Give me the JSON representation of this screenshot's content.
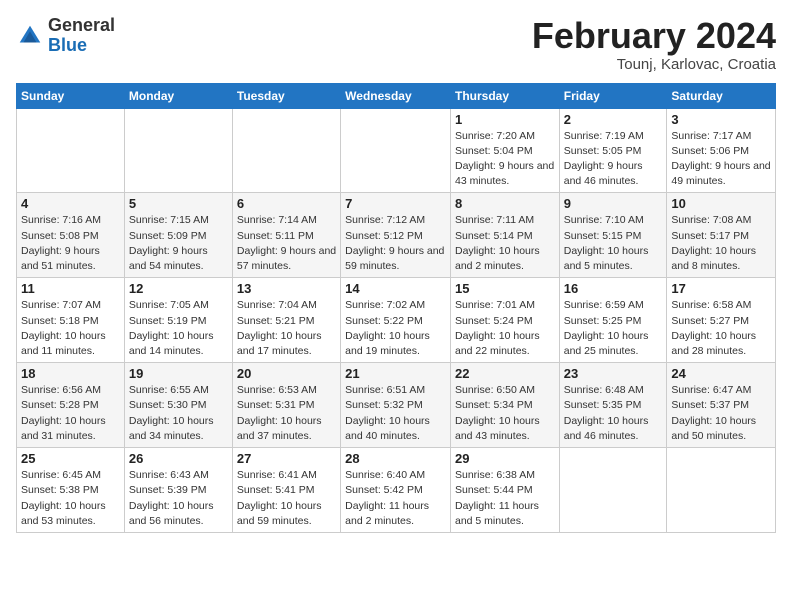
{
  "header": {
    "logo": {
      "general": "General",
      "blue": "Blue"
    },
    "title": "February 2024",
    "location": "Tounj, Karlovac, Croatia"
  },
  "calendar": {
    "weekdays": [
      "Sunday",
      "Monday",
      "Tuesday",
      "Wednesday",
      "Thursday",
      "Friday",
      "Saturday"
    ],
    "weeks": [
      [
        {
          "day": "",
          "sunrise": "",
          "sunset": "",
          "daylight": ""
        },
        {
          "day": "",
          "sunrise": "",
          "sunset": "",
          "daylight": ""
        },
        {
          "day": "",
          "sunrise": "",
          "sunset": "",
          "daylight": ""
        },
        {
          "day": "",
          "sunrise": "",
          "sunset": "",
          "daylight": ""
        },
        {
          "day": "1",
          "sunrise": "Sunrise: 7:20 AM",
          "sunset": "Sunset: 5:04 PM",
          "daylight": "Daylight: 9 hours and 43 minutes."
        },
        {
          "day": "2",
          "sunrise": "Sunrise: 7:19 AM",
          "sunset": "Sunset: 5:05 PM",
          "daylight": "Daylight: 9 hours and 46 minutes."
        },
        {
          "day": "3",
          "sunrise": "Sunrise: 7:17 AM",
          "sunset": "Sunset: 5:06 PM",
          "daylight": "Daylight: 9 hours and 49 minutes."
        }
      ],
      [
        {
          "day": "4",
          "sunrise": "Sunrise: 7:16 AM",
          "sunset": "Sunset: 5:08 PM",
          "daylight": "Daylight: 9 hours and 51 minutes."
        },
        {
          "day": "5",
          "sunrise": "Sunrise: 7:15 AM",
          "sunset": "Sunset: 5:09 PM",
          "daylight": "Daylight: 9 hours and 54 minutes."
        },
        {
          "day": "6",
          "sunrise": "Sunrise: 7:14 AM",
          "sunset": "Sunset: 5:11 PM",
          "daylight": "Daylight: 9 hours and 57 minutes."
        },
        {
          "day": "7",
          "sunrise": "Sunrise: 7:12 AM",
          "sunset": "Sunset: 5:12 PM",
          "daylight": "Daylight: 9 hours and 59 minutes."
        },
        {
          "day": "8",
          "sunrise": "Sunrise: 7:11 AM",
          "sunset": "Sunset: 5:14 PM",
          "daylight": "Daylight: 10 hours and 2 minutes."
        },
        {
          "day": "9",
          "sunrise": "Sunrise: 7:10 AM",
          "sunset": "Sunset: 5:15 PM",
          "daylight": "Daylight: 10 hours and 5 minutes."
        },
        {
          "day": "10",
          "sunrise": "Sunrise: 7:08 AM",
          "sunset": "Sunset: 5:17 PM",
          "daylight": "Daylight: 10 hours and 8 minutes."
        }
      ],
      [
        {
          "day": "11",
          "sunrise": "Sunrise: 7:07 AM",
          "sunset": "Sunset: 5:18 PM",
          "daylight": "Daylight: 10 hours and 11 minutes."
        },
        {
          "day": "12",
          "sunrise": "Sunrise: 7:05 AM",
          "sunset": "Sunset: 5:19 PM",
          "daylight": "Daylight: 10 hours and 14 minutes."
        },
        {
          "day": "13",
          "sunrise": "Sunrise: 7:04 AM",
          "sunset": "Sunset: 5:21 PM",
          "daylight": "Daylight: 10 hours and 17 minutes."
        },
        {
          "day": "14",
          "sunrise": "Sunrise: 7:02 AM",
          "sunset": "Sunset: 5:22 PM",
          "daylight": "Daylight: 10 hours and 19 minutes."
        },
        {
          "day": "15",
          "sunrise": "Sunrise: 7:01 AM",
          "sunset": "Sunset: 5:24 PM",
          "daylight": "Daylight: 10 hours and 22 minutes."
        },
        {
          "day": "16",
          "sunrise": "Sunrise: 6:59 AM",
          "sunset": "Sunset: 5:25 PM",
          "daylight": "Daylight: 10 hours and 25 minutes."
        },
        {
          "day": "17",
          "sunrise": "Sunrise: 6:58 AM",
          "sunset": "Sunset: 5:27 PM",
          "daylight": "Daylight: 10 hours and 28 minutes."
        }
      ],
      [
        {
          "day": "18",
          "sunrise": "Sunrise: 6:56 AM",
          "sunset": "Sunset: 5:28 PM",
          "daylight": "Daylight: 10 hours and 31 minutes."
        },
        {
          "day": "19",
          "sunrise": "Sunrise: 6:55 AM",
          "sunset": "Sunset: 5:30 PM",
          "daylight": "Daylight: 10 hours and 34 minutes."
        },
        {
          "day": "20",
          "sunrise": "Sunrise: 6:53 AM",
          "sunset": "Sunset: 5:31 PM",
          "daylight": "Daylight: 10 hours and 37 minutes."
        },
        {
          "day": "21",
          "sunrise": "Sunrise: 6:51 AM",
          "sunset": "Sunset: 5:32 PM",
          "daylight": "Daylight: 10 hours and 40 minutes."
        },
        {
          "day": "22",
          "sunrise": "Sunrise: 6:50 AM",
          "sunset": "Sunset: 5:34 PM",
          "daylight": "Daylight: 10 hours and 43 minutes."
        },
        {
          "day": "23",
          "sunrise": "Sunrise: 6:48 AM",
          "sunset": "Sunset: 5:35 PM",
          "daylight": "Daylight: 10 hours and 46 minutes."
        },
        {
          "day": "24",
          "sunrise": "Sunrise: 6:47 AM",
          "sunset": "Sunset: 5:37 PM",
          "daylight": "Daylight: 10 hours and 50 minutes."
        }
      ],
      [
        {
          "day": "25",
          "sunrise": "Sunrise: 6:45 AM",
          "sunset": "Sunset: 5:38 PM",
          "daylight": "Daylight: 10 hours and 53 minutes."
        },
        {
          "day": "26",
          "sunrise": "Sunrise: 6:43 AM",
          "sunset": "Sunset: 5:39 PM",
          "daylight": "Daylight: 10 hours and 56 minutes."
        },
        {
          "day": "27",
          "sunrise": "Sunrise: 6:41 AM",
          "sunset": "Sunset: 5:41 PM",
          "daylight": "Daylight: 10 hours and 59 minutes."
        },
        {
          "day": "28",
          "sunrise": "Sunrise: 6:40 AM",
          "sunset": "Sunset: 5:42 PM",
          "daylight": "Daylight: 11 hours and 2 minutes."
        },
        {
          "day": "29",
          "sunrise": "Sunrise: 6:38 AM",
          "sunset": "Sunset: 5:44 PM",
          "daylight": "Daylight: 11 hours and 5 minutes."
        },
        {
          "day": "",
          "sunrise": "",
          "sunset": "",
          "daylight": ""
        },
        {
          "day": "",
          "sunrise": "",
          "sunset": "",
          "daylight": ""
        }
      ]
    ]
  }
}
